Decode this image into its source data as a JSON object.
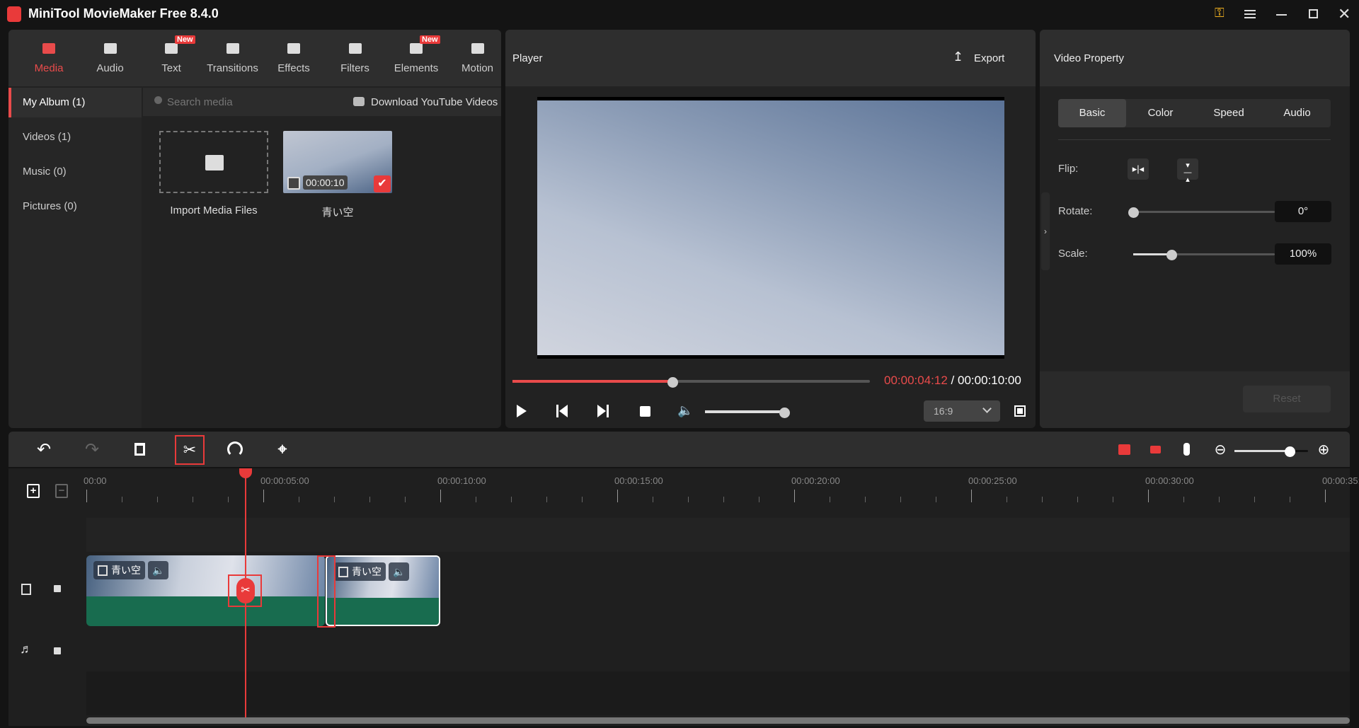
{
  "app": {
    "title": "MiniTool MovieMaker Free 8.4.0",
    "accent": "#e94b4b"
  },
  "top_tabs": [
    {
      "label": "Media",
      "icon": "folder-icon",
      "active": true
    },
    {
      "label": "Audio",
      "icon": "music-note-icon"
    },
    {
      "label": "Text",
      "icon": "text-icon",
      "badge": "New"
    },
    {
      "label": "Transitions",
      "icon": "transitions-icon"
    },
    {
      "label": "Effects",
      "icon": "effects-icon"
    },
    {
      "label": "Filters",
      "icon": "filters-icon"
    },
    {
      "label": "Elements",
      "icon": "elements-icon",
      "badge": "New"
    },
    {
      "label": "Motion",
      "icon": "motion-icon"
    }
  ],
  "sidebar": {
    "items": [
      {
        "label": "My Album (1)",
        "active": true
      },
      {
        "label": "Videos (1)"
      },
      {
        "label": "Music (0)"
      },
      {
        "label": "Pictures (0)"
      }
    ]
  },
  "media": {
    "search_placeholder": "Search media",
    "download_label": "Download YouTube Videos",
    "import_label": "Import Media Files",
    "items": [
      {
        "name": "青い空",
        "duration": "00:00:10",
        "selected": true
      }
    ]
  },
  "player": {
    "title": "Player",
    "export_label": "Export",
    "current_time": "00:00:04:12",
    "separator": " / ",
    "total_time": "00:00:10:00",
    "progress": 0.448,
    "volume": 0.97,
    "aspect_ratio": "16:9"
  },
  "property": {
    "title": "Video Property",
    "tabs": [
      "Basic",
      "Color",
      "Speed",
      "Audio"
    ],
    "active_tab": "Basic",
    "flip_label": "Flip:",
    "rotate_label": "Rotate:",
    "scale_label": "Scale:",
    "rotate_value": "0°",
    "scale_value": "100%",
    "rotate_fraction": 0.0,
    "scale_fraction": 0.27,
    "reset_label": "Reset"
  },
  "timeline": {
    "zoom_fraction": 0.75,
    "ruler_labels": [
      "00:00",
      "00:00:05:00",
      "00:00:10:00",
      "00:00:15:00",
      "00:00:20:00",
      "00:00:25:00",
      "00:00:30:00",
      "00:00:35:00"
    ],
    "ruler_label_seconds": [
      0,
      5,
      10,
      15,
      20,
      25,
      30,
      35
    ],
    "playhead_seconds": 4.48,
    "clips": [
      {
        "name": "青い空",
        "start": 0,
        "end": 6.74
      },
      {
        "name": "青い空",
        "start": 6.76,
        "end": 10,
        "selected": true
      }
    ]
  }
}
